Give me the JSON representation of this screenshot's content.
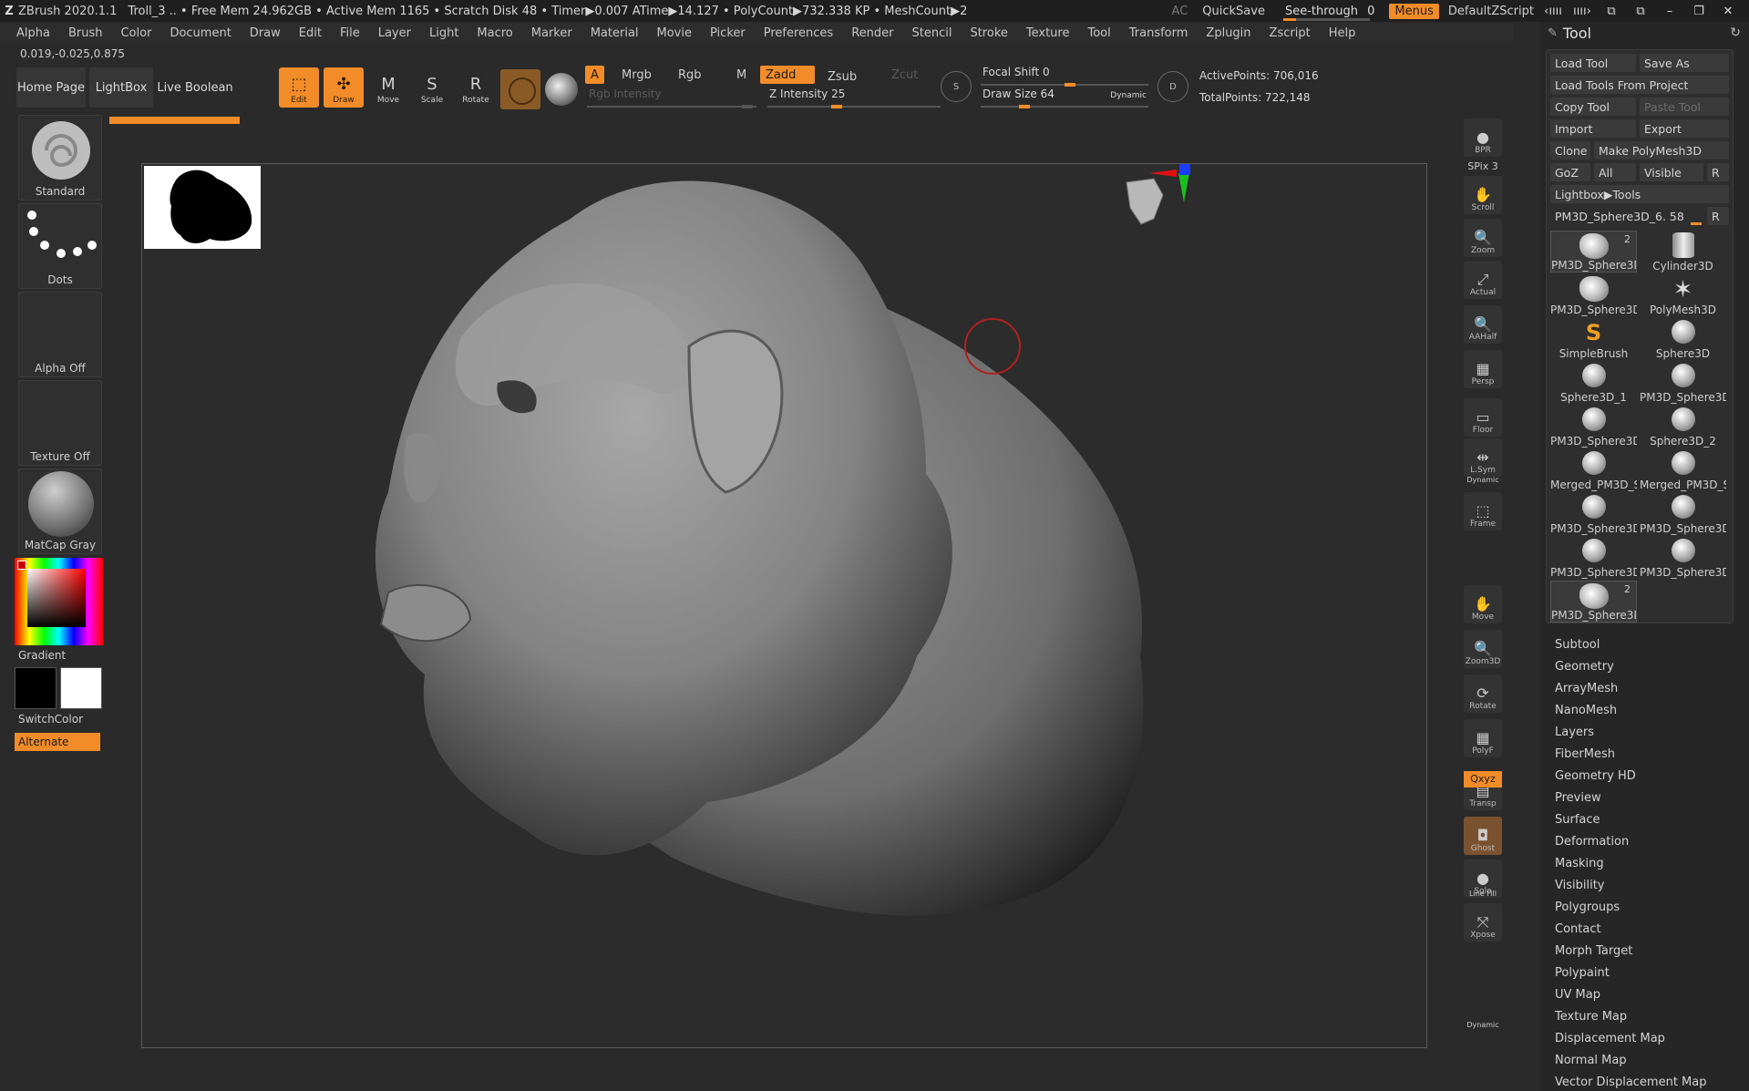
{
  "titlebar": {
    "app": "ZBrush 2020.1.1",
    "status": "Troll_3   .. • Free Mem 24.962GB • Active Mem 1165 • Scratch Disk 48 • Timer▶0.007 ATime▶14.127 • PolyCount▶732.338 KP • MeshCount▶2",
    "ac": "AC",
    "quicksave": "QuickSave",
    "seethrough_label": "See-through",
    "seethrough_value": "0",
    "seethrough_level": 0,
    "menus": "Menus",
    "default_zscript": "DefaultZScript"
  },
  "menubar": [
    "Alpha",
    "Brush",
    "Color",
    "Document",
    "Draw",
    "Edit",
    "File",
    "Layer",
    "Light",
    "Macro",
    "Marker",
    "Material",
    "Movie",
    "Picker",
    "Preferences",
    "Render",
    "Stencil",
    "Stroke",
    "Texture",
    "Tool",
    "Transform",
    "Zplugin",
    "Zscript",
    "Help"
  ],
  "coords": "0.019,-0.025,0.875",
  "shelf": {
    "home_page": "Home Page",
    "lightbox": "LightBox",
    "live_boolean": "Live Boolean",
    "edit": "Edit",
    "draw": "Draw",
    "move": "Move",
    "scale": "Scale",
    "rotate": "Rotate",
    "a": "A",
    "mrgb": "Mrgb",
    "rgb": "Rgb",
    "m": "M",
    "zadd": "Zadd",
    "zsub": "Zsub",
    "zcut": "Zcut",
    "rgb_intensity": "Rgb Intensity",
    "z_intensity": "Z Intensity 25",
    "focal_shift": "Focal Shift 0",
    "draw_size": "Draw Size 64",
    "dynamic": "Dynamic",
    "s": "S",
    "d": "D",
    "active_points": "ActivePoints: 706,016",
    "total_points": "TotalPoints: 722,148"
  },
  "left": {
    "standard": "Standard",
    "dots": "Dots",
    "alpha_off": "Alpha Off",
    "texture_off": "Texture Off",
    "matcap": "MatCap Gray",
    "gradient": "Gradient",
    "switchcolor": "SwitchColor",
    "alternate": "Alternate"
  },
  "rightshelf": [
    {
      "label": "BPR",
      "icon": "bpr-icon"
    },
    {
      "label": "Scroll",
      "icon": "scroll-icon"
    },
    {
      "label": "Zoom",
      "icon": "zoom-icon"
    },
    {
      "label": "Actual",
      "icon": "actual-icon"
    },
    {
      "label": "AAHalf",
      "icon": "aahalf-icon"
    },
    {
      "label": "Persp",
      "icon": "persp-icon"
    },
    {
      "label": "Floor",
      "icon": "floor-icon"
    },
    {
      "label": "L.Sym",
      "icon": "lsym-icon"
    },
    {
      "label": "Frame",
      "icon": "frame-icon"
    },
    {
      "label": "Move",
      "icon": "move-icon"
    },
    {
      "label": "Zoom3D",
      "icon": "zoom3d-icon"
    },
    {
      "label": "Rotate",
      "icon": "rotate-icon"
    },
    {
      "label": "PolyF",
      "icon": "polyf-icon"
    },
    {
      "label": "Transp",
      "icon": "transp-icon"
    },
    {
      "label": "Ghost",
      "icon": "ghost-icon"
    },
    {
      "label": "Solo",
      "icon": "solo-icon"
    },
    {
      "label": "Xpose",
      "icon": "xpose-icon"
    }
  ],
  "rightshelf_extra": {
    "spix": "SPix 3",
    "dynamic": "Dynamic",
    "linefill": "Line Fill",
    "xyz": "Qxyz",
    "dynamic2": "Dynamic"
  },
  "tool": {
    "header": "Tool",
    "load_tool": "Load Tool",
    "save_as": "Save As",
    "load_from_project": "Load Tools From Project",
    "copy_tool": "Copy Tool",
    "paste_tool": "Paste Tool",
    "import": "Import",
    "export": "Export",
    "clone": "Clone",
    "make_polymesh": "Make PolyMesh3D",
    "goz": "GoZ",
    "all": "All",
    "visible": "Visible",
    "r": "R",
    "lightbox_tools": "Lightbox▶Tools",
    "current": "PM3D_Sphere3D_6. 58",
    "current_r": "R",
    "items": [
      {
        "name": "PM3D_Sphere3D",
        "count": "2",
        "icon": "troll-icon"
      },
      {
        "name": "Cylinder3D",
        "count": "",
        "icon": "cylinder-icon"
      },
      {
        "name": "PM3D_Sphere3D",
        "count": "",
        "icon": "head-icon"
      },
      {
        "name": "PolyMesh3D",
        "count": "",
        "icon": "star-icon"
      },
      {
        "name": "SimpleBrush",
        "count": "",
        "icon": "simplebrush-icon"
      },
      {
        "name": "Sphere3D",
        "count": "",
        "icon": "sphere-icon"
      },
      {
        "name": "Sphere3D_1",
        "count": "",
        "icon": "sphere-icon"
      },
      {
        "name": "PM3D_Sphere3D",
        "count": "",
        "icon": "sphere-icon"
      },
      {
        "name": "PM3D_Sphere3D",
        "count": "",
        "icon": "sphere-icon"
      },
      {
        "name": "Sphere3D_2",
        "count": "",
        "icon": "sphere-icon"
      },
      {
        "name": "Merged_PM3D_S",
        "count": "",
        "icon": "sphere-icon"
      },
      {
        "name": "Merged_PM3D_S",
        "count": "",
        "icon": "sphere-icon"
      },
      {
        "name": "PM3D_Sphere3D",
        "count": "",
        "icon": "sphere-icon"
      },
      {
        "name": "PM3D_Sphere3D",
        "count": "",
        "icon": "sphere-icon"
      },
      {
        "name": "PM3D_Sphere3D",
        "count": "",
        "icon": "sphere-icon"
      },
      {
        "name": "PM3D_Sphere3D",
        "count": "",
        "icon": "sphere-icon"
      },
      {
        "name": "PM3D_Sphere3D",
        "count": "2",
        "icon": "troll-icon"
      }
    ],
    "submenus": [
      "Subtool",
      "Geometry",
      "ArrayMesh",
      "NanoMesh",
      "Layers",
      "FiberMesh",
      "Geometry HD",
      "Preview",
      "Surface",
      "Deformation",
      "Masking",
      "Visibility",
      "Polygroups",
      "Contact",
      "Morph Target",
      "Polypaint",
      "UV Map",
      "Texture Map",
      "Displacement Map",
      "Normal Map",
      "Vector Displacement Map"
    ]
  },
  "colors": {
    "accent": "#f28c28",
    "bg": "#2a2a2a"
  }
}
